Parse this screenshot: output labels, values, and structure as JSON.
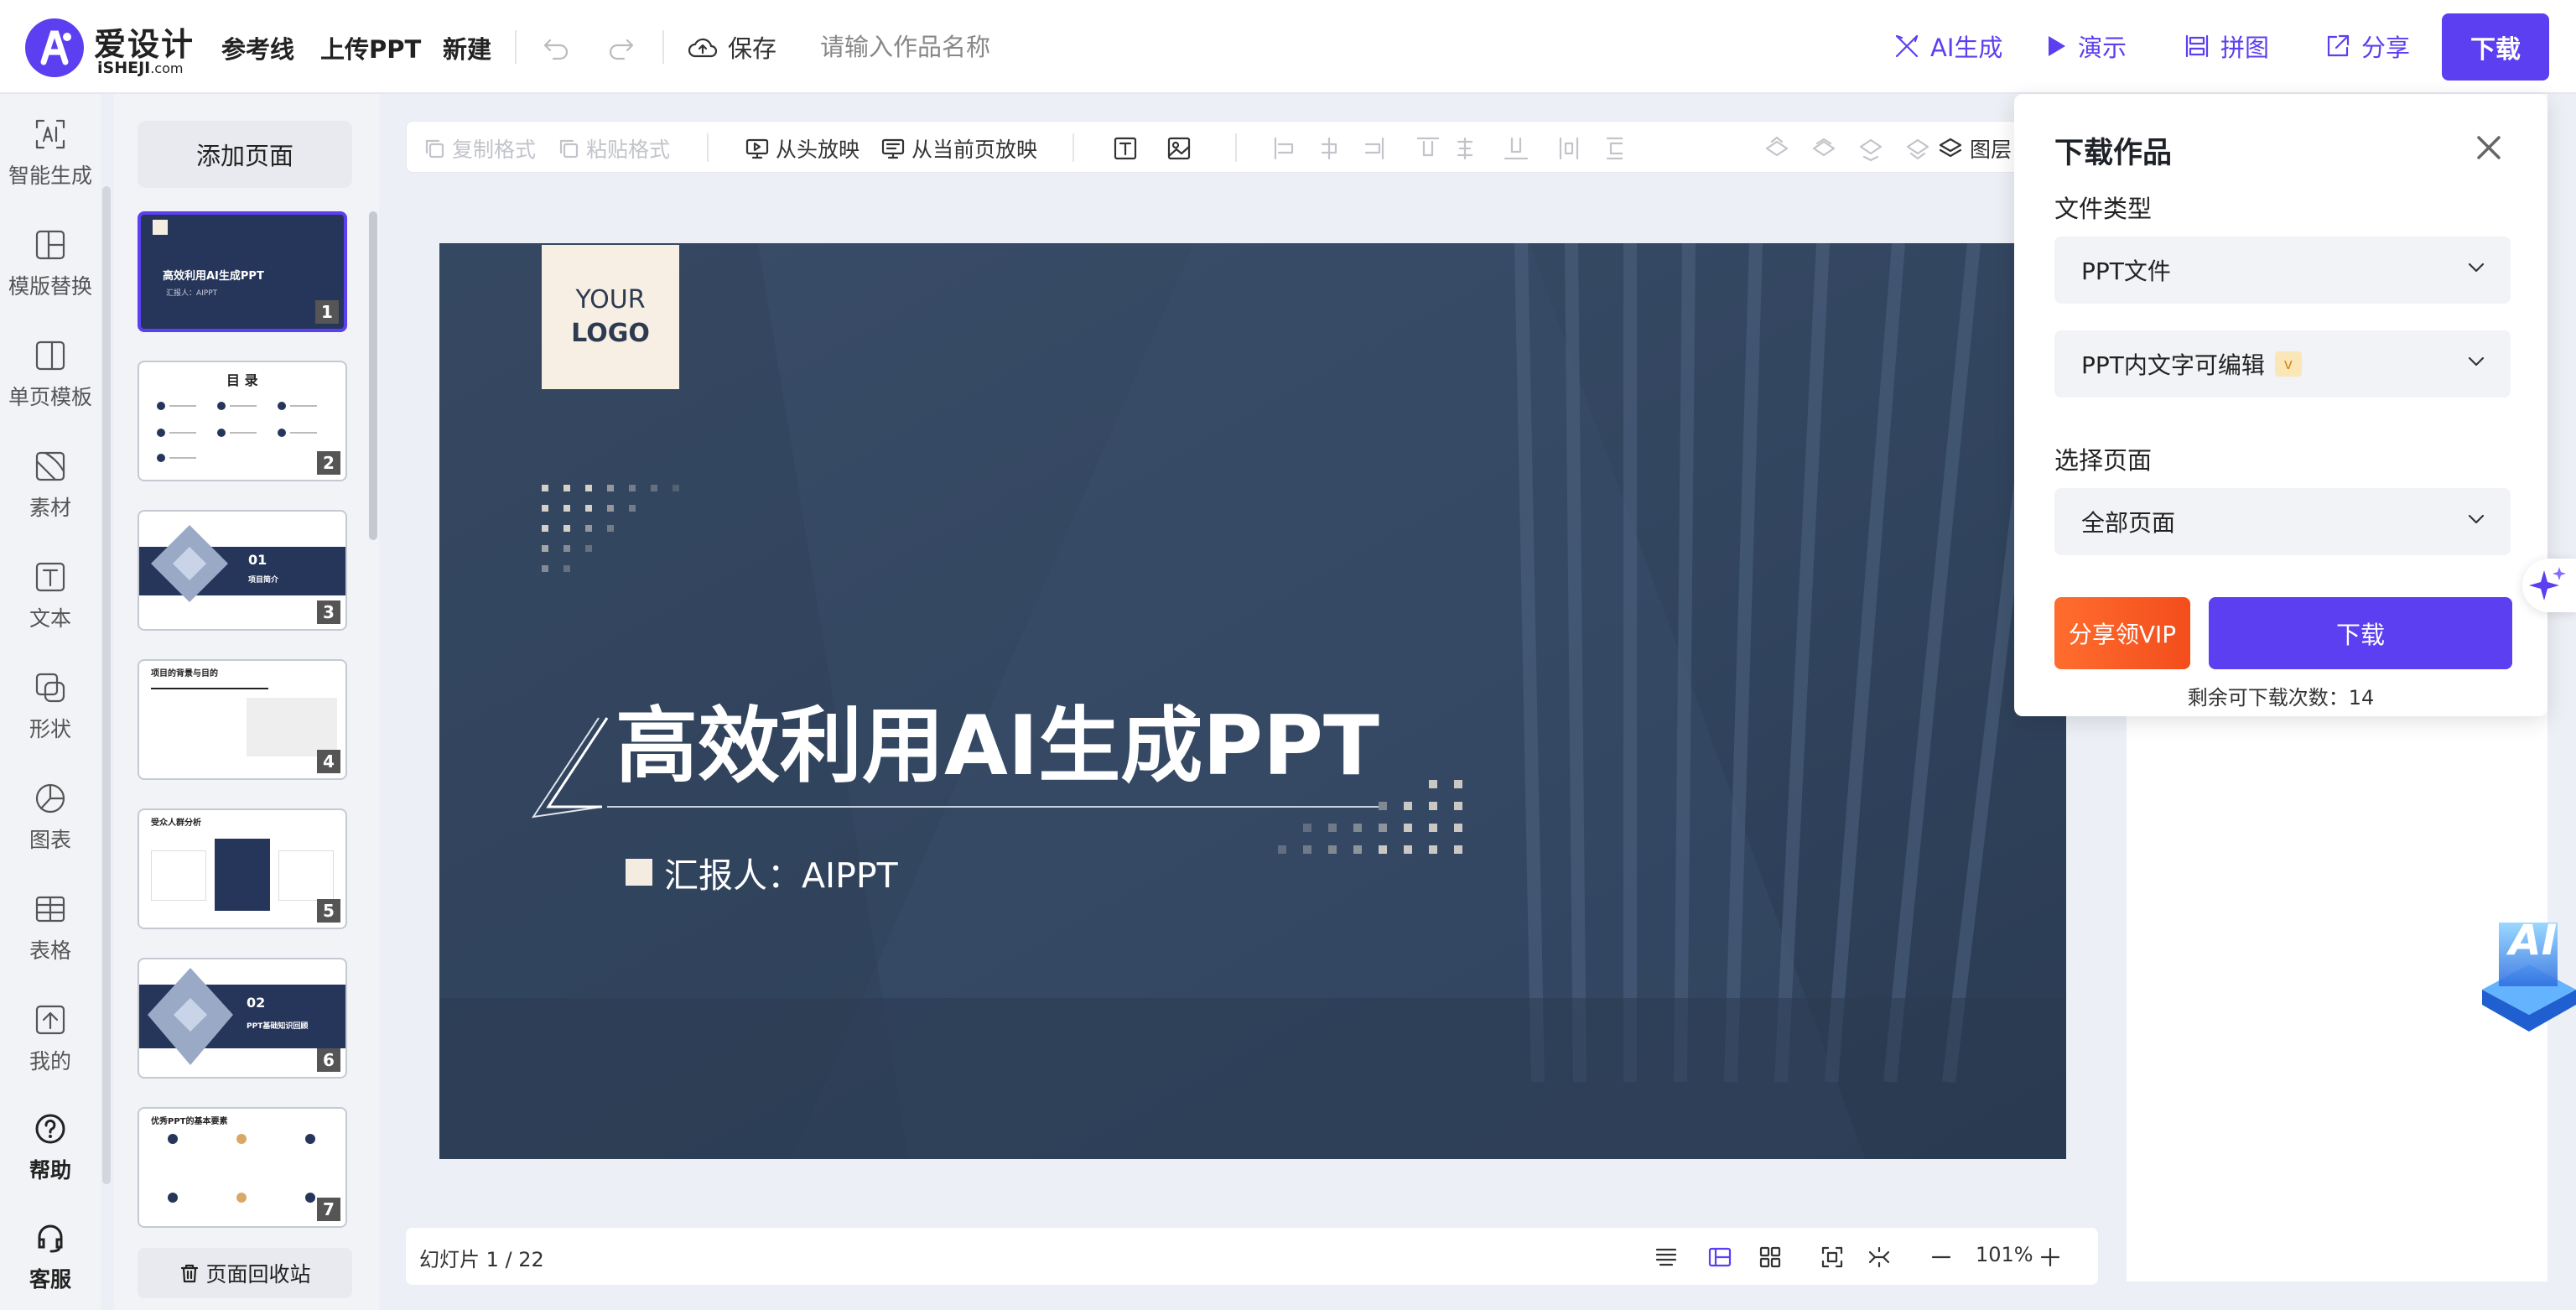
{
  "brand": {
    "name_cn": "爱设计",
    "name_en": "iSHEJI",
    "domain": ".com",
    "color": "#5b3ff0"
  },
  "topbar": {
    "menu": [
      "参考线",
      "上传PPT",
      "新建"
    ],
    "save_label": "保存",
    "doc_name_placeholder": "请输入作品名称",
    "actions": {
      "ai": "AI生成",
      "present": "演示",
      "collage": "拼图",
      "share": "分享",
      "download": "下载"
    }
  },
  "sidebar": {
    "items": [
      {
        "label": "智能生成",
        "icon": "ai-icon"
      },
      {
        "label": "模版替换",
        "icon": "layout-icon"
      },
      {
        "label": "单页模板",
        "icon": "single-page-icon"
      },
      {
        "label": "素材",
        "icon": "material-icon"
      },
      {
        "label": "文本",
        "icon": "text-icon"
      },
      {
        "label": "形状",
        "icon": "shape-icon"
      },
      {
        "label": "图表",
        "icon": "chart-icon"
      },
      {
        "label": "表格",
        "icon": "table-icon"
      },
      {
        "label": "我的",
        "icon": "upload-icon"
      }
    ],
    "help": "帮助",
    "service": "客服"
  },
  "thumbnails": {
    "add_page": "添加页面",
    "recycle": "页面回收站",
    "pages": [
      {
        "num": "1",
        "title": "高效利用AI生成PPT",
        "sub": "汇报人：AIPPT"
      },
      {
        "num": "2",
        "title": "目 录"
      },
      {
        "num": "3",
        "title": "01",
        "sub": "项目简介"
      },
      {
        "num": "4",
        "title": "项目的背景与目的"
      },
      {
        "num": "5",
        "title": "受众人群分析"
      },
      {
        "num": "6",
        "title": "02",
        "sub": "PPT基础知识回顾"
      },
      {
        "num": "7",
        "title": "优秀PPT的基本要素"
      }
    ]
  },
  "toolbar": {
    "copy_format": "复制格式",
    "paste_format": "粘贴格式",
    "play_start": "从头放映",
    "play_current": "从当前页放映",
    "layers": "图层"
  },
  "slide": {
    "logo_line1": "YOUR",
    "logo_line2": "LOGO",
    "title": "高效利用AI生成PPT",
    "subtitle": "汇报人：AIPPT"
  },
  "statusbar": {
    "slide_count": "幻灯片 1 / 22",
    "zoom": "101%"
  },
  "download_popup": {
    "title": "下载作品",
    "file_type_label": "文件类型",
    "file_type_value": "PPT文件",
    "option_value": "PPT内文字可编辑",
    "vip_badge": "v",
    "page_label": "选择页面",
    "page_value": "全部页面",
    "share_vip": "分享领VIP",
    "download": "下载",
    "remaining": "剩余可下载次数：14"
  },
  "ai_badge": "AI"
}
